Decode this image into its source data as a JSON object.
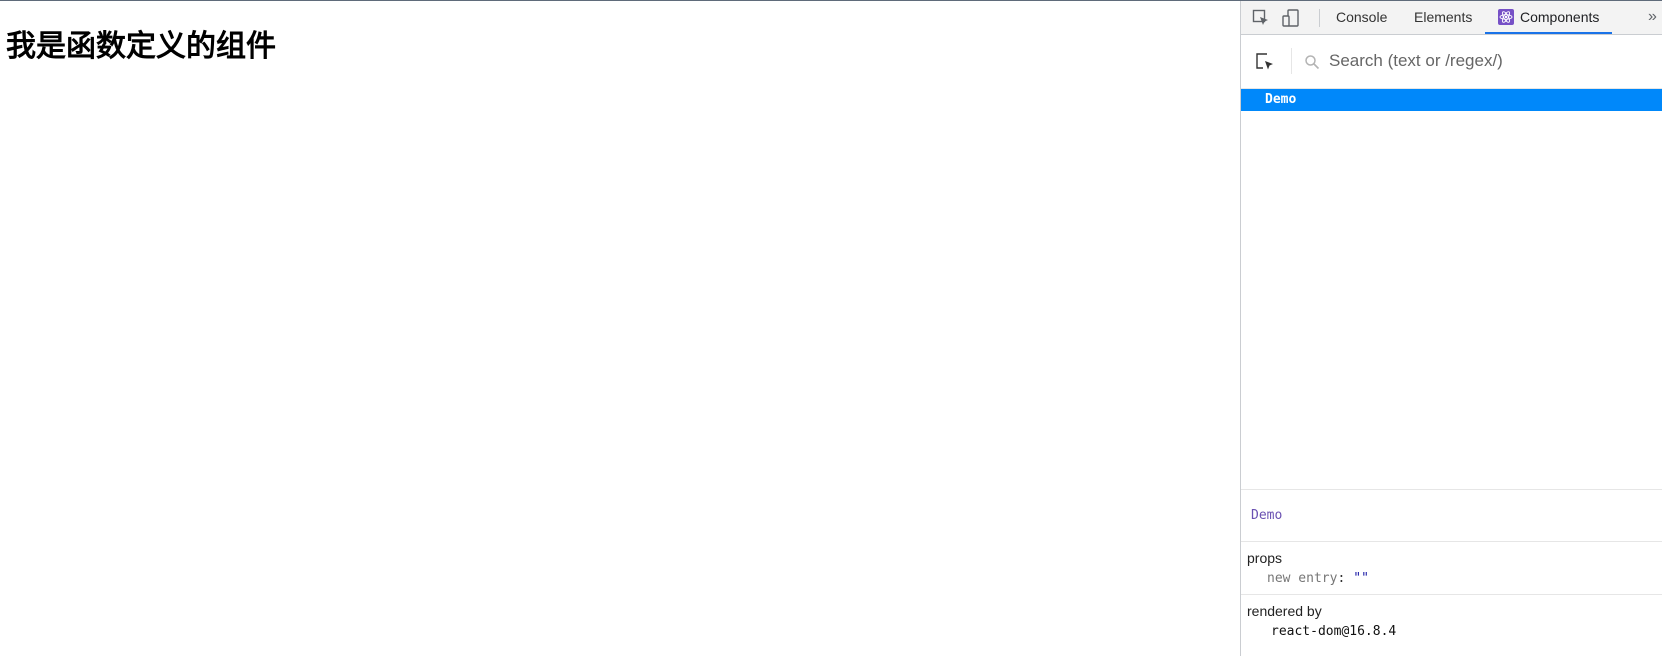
{
  "page": {
    "heading": "我是函数定义的组件"
  },
  "devtools": {
    "tabs": {
      "console": "Console",
      "elements": "Elements",
      "components": "Components",
      "more": "»"
    },
    "search": {
      "placeholder": "Search (text or /regex/)"
    },
    "tree": {
      "selected": "Demo"
    },
    "details": {
      "component_name": "Demo",
      "props_title": "props",
      "props": [
        {
          "key": "new entry",
          "value": "\"\""
        }
      ],
      "rendered_by_title": "rendered by",
      "rendered_by": "react-dom@16.8.4"
    },
    "colors": {
      "selection": "#0088fa",
      "active_tab_underline": "#1a73e8",
      "component_name": "#6a51b2"
    }
  }
}
